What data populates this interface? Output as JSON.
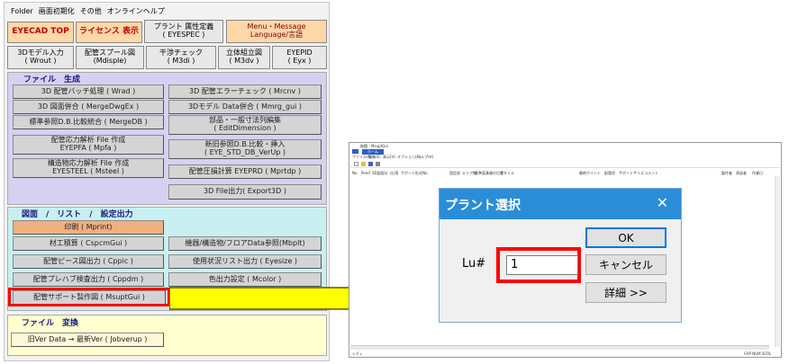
{
  "menu": {
    "items": [
      "Folder",
      "画面初期化",
      "その他",
      "オンラインヘルプ"
    ]
  },
  "top_buttons": [
    {
      "label": "EYECAD TOP"
    },
    {
      "label": "ライセンス 表示"
    },
    {
      "label": "プラント 属性定義\n( EYESPEC )"
    },
    {
      "label": "Menu・Message\nLanguage/言語"
    },
    {
      "label": "3Dモデル入力\n( Wrout )"
    },
    {
      "label": "配管スプール図\n(Mdisple)"
    },
    {
      "label": "干渉チェック\n( M3di )"
    },
    {
      "label": "立体組立図\n( M3dv )"
    },
    {
      "label": "EYEPID\n( Eyx )"
    }
  ],
  "section_file_create": {
    "title": "ファイル　生成",
    "buttons": [
      "3D 配管バッチ処理 ( Wrad )",
      "3D 配管エラーチェック ( Mrcnv )",
      "3D 図面併合 ( MergeDwgEx )",
      "3Dモデル Data併合 ( Mmrg_gui )",
      "標準参照D.B.比較統合 ( MergeDB )",
      "部品・一般寸法列編集\n( EditDimension )",
      "配管応力解析 File 作成\nEYEPFA   ( Mpfa )",
      "新旧参照D.B.比較・挿入\n( EYE_STD_DB_VerUp )",
      "構造物応力解析 File 作成\nEYESTEEL   ( Msteel )",
      "配管圧損計算 EYEPRD  ( Mprtdp )",
      "3D File出力( Export3D )"
    ]
  },
  "section_drawing": {
    "title": "図面　/　リスト　/　設定出力",
    "buttons": [
      "印刷 ( Mprint)",
      "材工積算 ( CspcmGui )",
      "機器/構造物/フロアData参照(Mbplt)",
      "配管ピース図出力 ( Cppic )",
      "使用状況リスト出力 ( Eyesize )",
      "配管プレハブ検査出力 ( Cppdm )",
      "色出力設定 ( Mcolor )",
      "配管サポート製作図 ( MsuptGui )"
    ]
  },
  "section_convert": {
    "title": "ファイル　変換",
    "button": "旧Ver Data → 最新Ver ( Jobverup )"
  },
  "app_window": {
    "title": "無題 - MsuptGui",
    "tab": "ホーム",
    "menus": [
      "ファイル(F)",
      "編集(E)",
      "表示(V)",
      "オプション(O)",
      "ヘルプ(H)"
    ],
    "columns": [
      "No.",
      "Pend",
      "3D図面分",
      "仕/用",
      "サポート形式No.",
      "固定部",
      "エリア数",
      "基準面",
      "基礎の位置",
      "スタイル",
      "最終ポイント",
      "配管径",
      "サポートサイズ",
      "コメント",
      "製作者",
      "承認者",
      "作業日"
    ],
    "status_left": "レディ",
    "status_right": "CAP NUM SCRL"
  },
  "dialog": {
    "title": "プラント選択",
    "close": "✕",
    "field_label": "Lu#",
    "field_value": "1",
    "ok": "OK",
    "cancel": "キャンセル",
    "detail": "詳細 >>"
  },
  "colors": {
    "highlight": "#ff0000",
    "arrow_fill": "#ffff00",
    "dialog_title": "#2a8dd8",
    "section_file_create_bg": "#d8d0f0",
    "section_drawing_bg": "#c8f0f0",
    "section_convert_bg": "#ffffd0"
  }
}
